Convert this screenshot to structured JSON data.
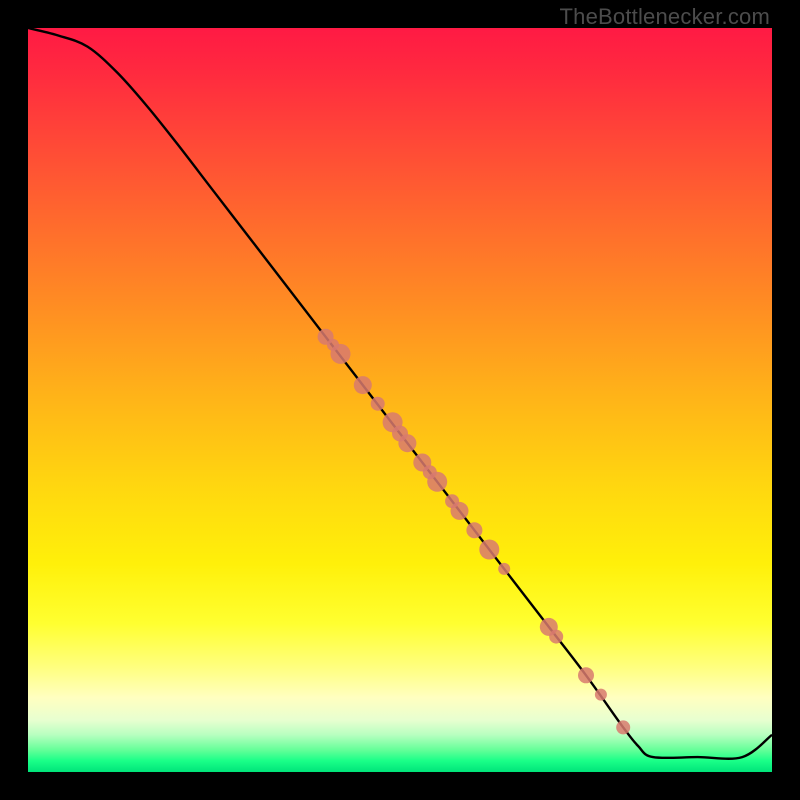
{
  "watermark": "TheBottlenecker.com",
  "chart_data": {
    "type": "line",
    "title": "",
    "xlabel": "",
    "ylabel": "",
    "xlim": [
      0,
      100
    ],
    "ylim": [
      0,
      100
    ],
    "series": [
      {
        "name": "bottleneck-curve",
        "x": [
          0,
          4,
          8,
          12,
          16,
          20,
          25,
          30,
          35,
          40,
          45,
          50,
          55,
          60,
          65,
          70,
          75,
          80,
          82,
          84,
          90,
          96,
          100
        ],
        "y": [
          100,
          99,
          97.5,
          94,
          89.5,
          84.5,
          78,
          71.5,
          65,
          58.5,
          52,
          45.5,
          39,
          32.5,
          26,
          19.5,
          13,
          6,
          3.5,
          2,
          2,
          2,
          5
        ],
        "color": "#000000"
      }
    ],
    "markers": {
      "name": "data-points",
      "color": "#d87a6e",
      "points": [
        {
          "x": 40,
          "y": 58.5,
          "r": 8
        },
        {
          "x": 41,
          "y": 57.4,
          "r": 6
        },
        {
          "x": 42,
          "y": 56.2,
          "r": 10
        },
        {
          "x": 45,
          "y": 52.0,
          "r": 9
        },
        {
          "x": 47,
          "y": 49.5,
          "r": 7
        },
        {
          "x": 49,
          "y": 47.0,
          "r": 10
        },
        {
          "x": 50,
          "y": 45.5,
          "r": 8
        },
        {
          "x": 51,
          "y": 44.2,
          "r": 9
        },
        {
          "x": 53,
          "y": 41.6,
          "r": 9
        },
        {
          "x": 54,
          "y": 40.3,
          "r": 7
        },
        {
          "x": 55,
          "y": 39.0,
          "r": 10
        },
        {
          "x": 57,
          "y": 36.4,
          "r": 7
        },
        {
          "x": 58,
          "y": 35.1,
          "r": 9
        },
        {
          "x": 60,
          "y": 32.5,
          "r": 8
        },
        {
          "x": 62,
          "y": 29.9,
          "r": 10
        },
        {
          "x": 64,
          "y": 27.3,
          "r": 6
        },
        {
          "x": 70,
          "y": 19.5,
          "r": 9
        },
        {
          "x": 71,
          "y": 18.2,
          "r": 7
        },
        {
          "x": 75,
          "y": 13.0,
          "r": 8
        },
        {
          "x": 77,
          "y": 10.4,
          "r": 6
        },
        {
          "x": 80,
          "y": 6.0,
          "r": 7
        }
      ]
    }
  }
}
